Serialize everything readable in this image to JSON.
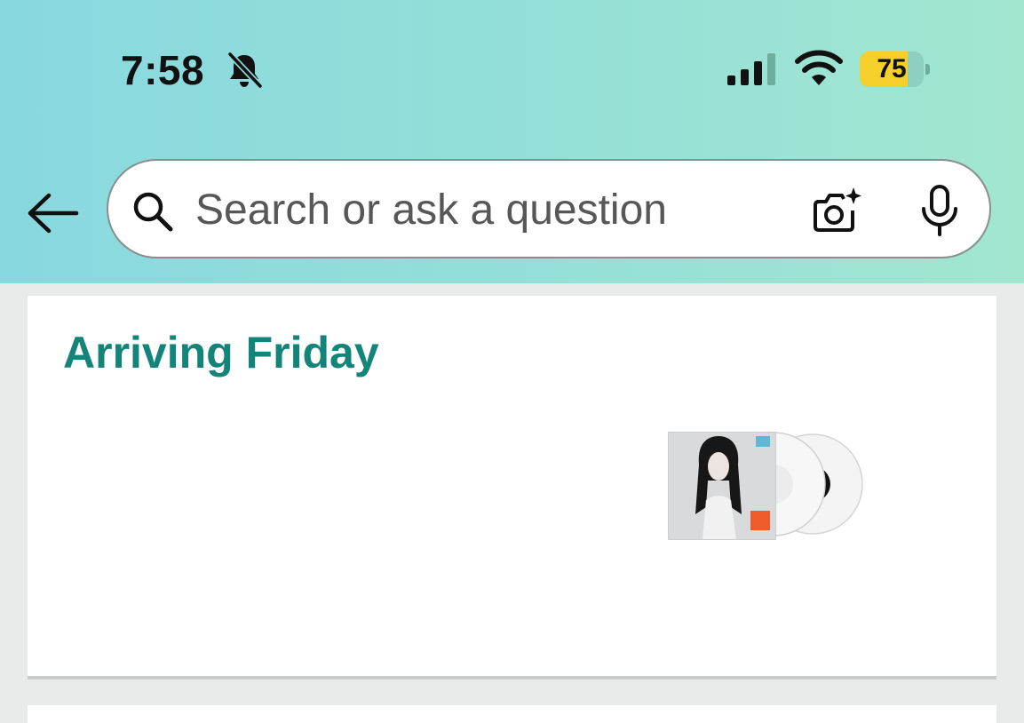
{
  "status_bar": {
    "time": "7:58",
    "battery_level": "75",
    "battery_fraction": 0.75,
    "icons": [
      "bell-slash-icon",
      "cellular-signal-icon",
      "wifi-icon",
      "battery-icon"
    ]
  },
  "search": {
    "placeholder": "Search or ask a question",
    "value": "",
    "icons": [
      "back-arrow-icon",
      "search-icon",
      "camera-icon",
      "microphone-icon"
    ]
  },
  "delivery": {
    "heading": "Arriving Friday"
  },
  "colors": {
    "header_gradient_start": "#88d8df",
    "header_gradient_end": "#a2e6d0",
    "heading_teal": "#12847a",
    "battery_yellow": "#f5d02a",
    "page_background": "#e9ebea"
  }
}
